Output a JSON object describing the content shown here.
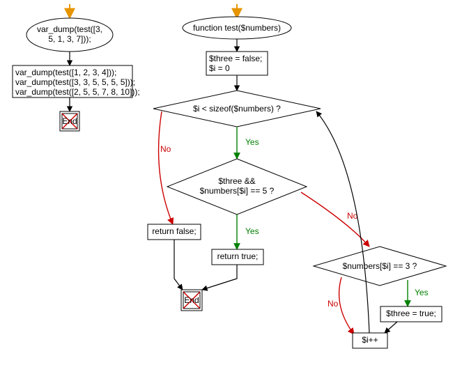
{
  "left": {
    "call1": "var_dump(test([3, 5, 1, 3, 7]));",
    "calls": [
      "var_dump(test([1, 2, 3, 4]));",
      "var_dump(test([3, 3, 5, 5, 5, 5]));",
      "var_dump(test([2, 5, 5, 7, 8, 10]));"
    ],
    "end": "End"
  },
  "right": {
    "func": "function test($numbers)",
    "init1": "$three = false;",
    "init2": "$i = 0",
    "cond1": "$i < sizeof($numbers) ?",
    "cond2a": "$three &&",
    "cond2b": "$numbers[$i] == 5 ?",
    "cond3": "$numbers[$i] == 3 ?",
    "ret_false": "return false;",
    "ret_true": "return true;",
    "set_three": "$three = true;",
    "inc": "$i++",
    "end": "End"
  },
  "labels": {
    "yes": "Yes",
    "no": "No"
  }
}
